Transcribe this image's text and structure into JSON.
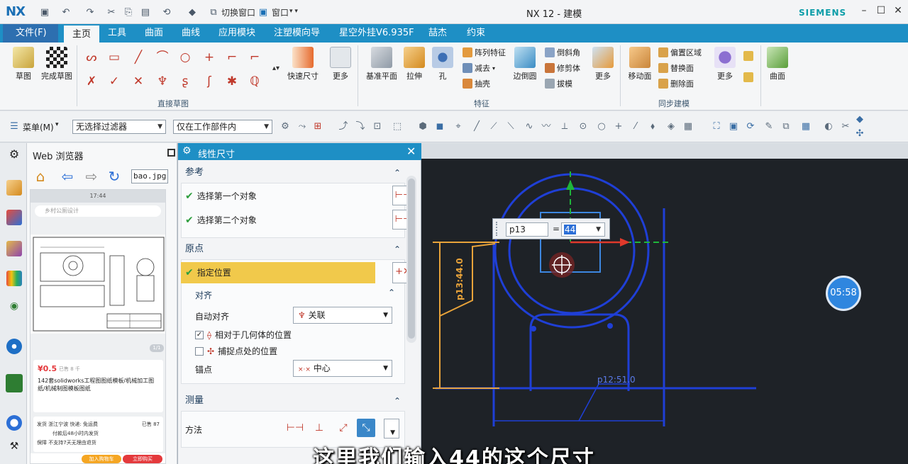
{
  "titlebar": {
    "logo": "NX",
    "title": "NX 12 - 建模",
    "brand": "SIEMENS",
    "switch_window": "切换窗口",
    "window_menu": "窗口"
  },
  "menubar": {
    "tabs": [
      "文件(F)",
      "主页",
      "工具",
      "曲面",
      "曲线",
      "应用模块",
      "注塑模向导",
      "星空外挂V6.935F",
      "喆杰",
      "约束"
    ],
    "active": "主页",
    "search_value": "拉伸"
  },
  "ribbon": {
    "sketch": "草图",
    "finish_sketch": "完成草图",
    "quick_dim": "快速尺寸",
    "more1": "更多",
    "datum_plane": "基准平面",
    "extrude": "拉伸",
    "hole": "孔",
    "pattern_feature": "阵列特征",
    "subtract": "减去",
    "shell": "抽壳",
    "edge_blend": "边倒圆",
    "chamfer": "倒斜角",
    "trim_body": "修剪体",
    "draft": "拔模",
    "more2": "更多",
    "move_face": "移动面",
    "offset_region": "偏置区域",
    "replace_face": "替换面",
    "delete_face": "删除面",
    "more3": "更多",
    "surface": "曲面",
    "group_direct_sketch": "直接草图",
    "group_feature": "特征",
    "group_sync": "同步建模"
  },
  "toolbar2": {
    "menu": "菜单(M)",
    "filter": "无选择过滤器",
    "scope": "仅在工作部件内"
  },
  "browser": {
    "title": "Web 浏览器",
    "url": "bao.jpg",
    "phone_time": "17:44",
    "phone_search": "乡村公厕设计",
    "page_indicator": "1/1",
    "price": "¥0.5",
    "sold": "已售 8 千",
    "product_title": "142套solidworks工程图图纸模板/机械加工图纸/机械制图模板图纸",
    "origin_label": "发货",
    "origin": "浙江宁波",
    "express": "快递: 免运费",
    "ship_time": "付款后48小时内发货",
    "guarantee_label": "保障",
    "guarantee": "不支持7天无理由退货",
    "sold_count": "已售 87",
    "add_cart": "加入购物车",
    "buy_now": "立即购买"
  },
  "dialog": {
    "title": "线性尺寸",
    "sec_reference": "参考",
    "select_first": "选择第一个对象",
    "select_second": "选择第二个对象",
    "sec_origin": "原点",
    "specify_location": "指定位置",
    "sec_align": "对齐",
    "auto_align_label": "自动对齐",
    "auto_align_value": "关联",
    "relative_geom": "相对于几何体的位置",
    "snap_point": "捕捉点处的位置",
    "anchor_label": "锚点",
    "anchor_value": "中心",
    "sec_measure": "测量",
    "method_label": "方法"
  },
  "graphics": {
    "timer": "05:58",
    "dim_name": "p13",
    "dim_value": "44",
    "dim_label_left": "p13:44.0",
    "dim_label_bottom": "p12:51.0"
  },
  "subtitle": "这里我们输入44的这个尺寸",
  "colors": {
    "accent": "#1e8fc5",
    "sketch_blue": "#1f3fd6",
    "dim_orange": "#e8a33a",
    "highlight": "#f1c94b"
  }
}
